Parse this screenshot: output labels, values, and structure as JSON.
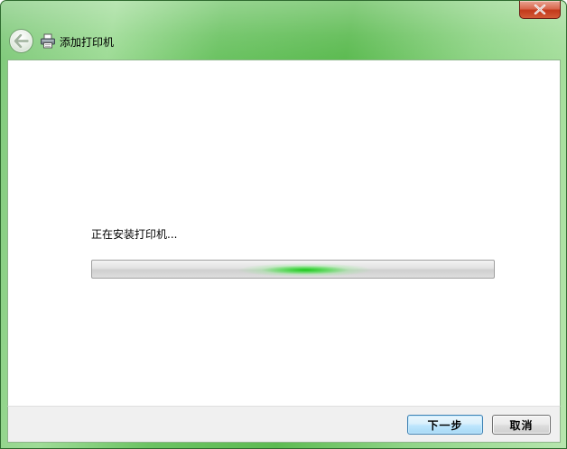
{
  "window": {
    "title": "添加打印机"
  },
  "icons": {
    "close": "close-icon",
    "back": "back-arrow-icon",
    "printer": "printer-icon"
  },
  "content": {
    "status_text": "正在安装打印机..."
  },
  "progress": {
    "mode": "indeterminate",
    "glow_center_fraction": 0.53
  },
  "buttons": {
    "next_label": "下一步",
    "cancel_label": "取消"
  },
  "colors": {
    "aero_frame": "#6cc363",
    "progress_glow": "#1ac81a",
    "close_button": "#c2391b",
    "default_button_border": "#3c7fb1"
  }
}
